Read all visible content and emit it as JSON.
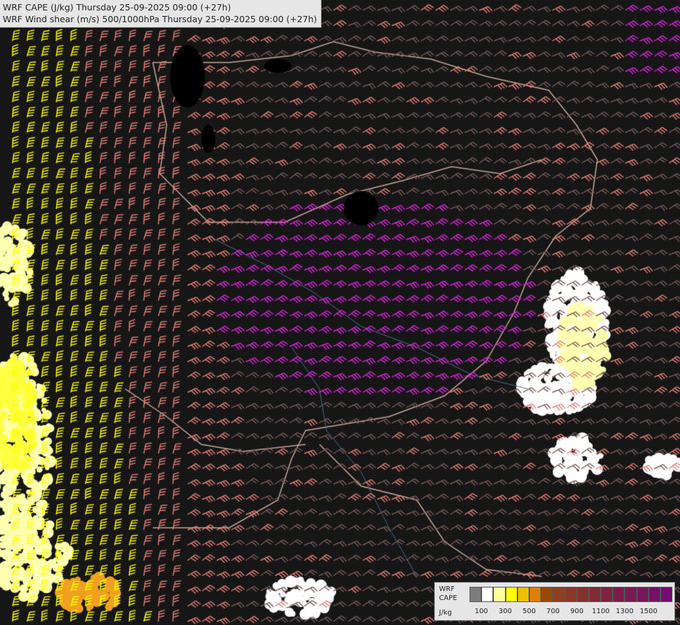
{
  "title": {
    "line1": "WRF CAPE (J/kg) Thursday 25-09-2025 09:00 (+27h)",
    "line2": "WRF Wind shear (m/s) 500/1000hPa Thursday 25-09-2025 09:00 (+27h)"
  },
  "legend": {
    "label_line1": "WRF",
    "label_line2": "CAPE",
    "label_line3": "J/kg",
    "ticks": [
      "100",
      "300",
      "500",
      "700",
      "900",
      "1100",
      "1300",
      "1500"
    ],
    "colors": [
      "#7d7d7d",
      "#ffffff",
      "#ffff99",
      "#ffff00",
      "#f0c000",
      "#e08000",
      "#9a4a00",
      "#8e4020",
      "#8a3828",
      "#86302e",
      "#822a36",
      "#7e243e",
      "#7a1e48",
      "#781a52",
      "#76165c",
      "#741266",
      "#720e70"
    ]
  },
  "map": {
    "barb_colors": {
      "low": "#7a5a5a",
      "mid": "#e88078",
      "high_magenta": "#e020e0",
      "strong_yellow": "#ffff00"
    },
    "cape_colors": {
      "white": "#ffffff",
      "pale": "#ffffb0",
      "yellow": "#ffff40",
      "orange": "#f0a020"
    }
  }
}
